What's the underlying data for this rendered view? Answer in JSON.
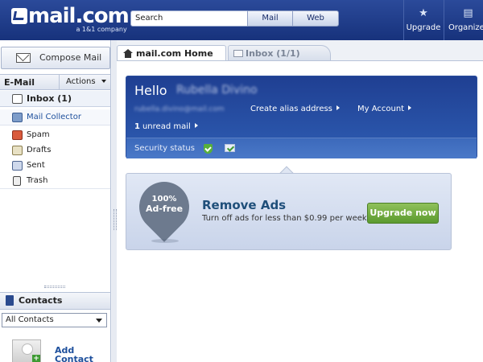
{
  "header": {
    "logo_main": "mail.com",
    "logo_sub": "a 1&1 company",
    "search_placeholder": "Search",
    "search_mail": "Mail",
    "search_web": "Web",
    "upgrade": "Upgrade",
    "organize": "Organizer"
  },
  "sidebar": {
    "compose": "Compose Mail",
    "email_label": "E-Mail",
    "actions": "Actions",
    "folders": {
      "inbox": "Inbox (1)",
      "collector": "Mail Collector",
      "spam": "Spam",
      "drafts": "Drafts",
      "sent": "Sent",
      "trash": "Trash"
    },
    "contacts_label": "Contacts",
    "contacts_select": "All Contacts",
    "add_contact": "Add Contact"
  },
  "tabs": {
    "home": "mail.com Home",
    "inbox": "Inbox (1/1)"
  },
  "welcome": {
    "hello": "Hello",
    "name": "Rubella Divino",
    "email": "rubella.divino@mail.com",
    "alias_link": "Create alias address",
    "account_link": "My Account",
    "unread_count": "1",
    "unread_label": "unread mail",
    "security_label": "Security status"
  },
  "ads": {
    "badge_line1": "100%",
    "badge_line2": "Ad-free",
    "title": "Remove Ads",
    "subtitle": "Turn off ads for less than $0.99 per week!",
    "button": "Upgrade now"
  },
  "colors": {
    "header_blue": "#1f3c8a",
    "card_blue": "#2e5db3",
    "upgrade_green": "#6aa83a"
  }
}
